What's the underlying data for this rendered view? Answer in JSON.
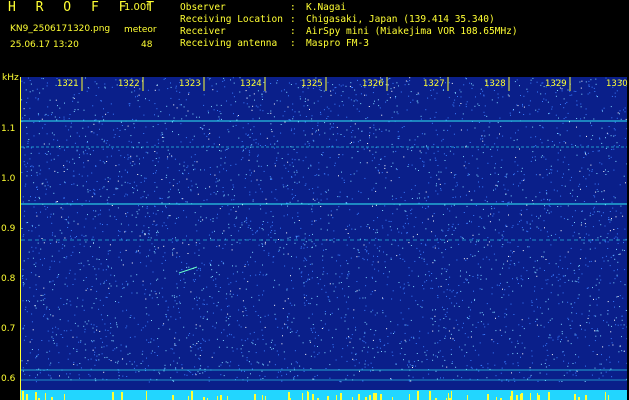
{
  "header": {
    "app_title": "H R O F F T",
    "version": "1.00f",
    "filename": "KN9_2506171320.png",
    "meteor_label": "meteor",
    "datetime": "25.06.17 13:20",
    "meteor_count": "48",
    "info": [
      {
        "key": "Observer",
        "value": "K.Nagai"
      },
      {
        "key": "Receiving Location",
        "value": "Chigasaki, Japan (139.414 35.340)"
      },
      {
        "key": "Receiver",
        "value": "AirSpy mini (Miakejima VOR 108.65MHz)"
      },
      {
        "key": "Receiving antenna",
        "value": "Maspro FM-3"
      }
    ]
  },
  "axis": {
    "y_unit": "kHz",
    "x_ticks": [
      "1321",
      "1322",
      "1323",
      "1324",
      "1325",
      "1326",
      "1327",
      "1328",
      "1329",
      "1330"
    ],
    "y_ticks": [
      "1.1",
      "1.0",
      "0.9",
      "0.8",
      "0.7",
      "0.6"
    ]
  },
  "colors": {
    "background": "#000000",
    "plot": "#0a1f8a",
    "text": "#ffff33",
    "signal": "#33ffff"
  }
}
